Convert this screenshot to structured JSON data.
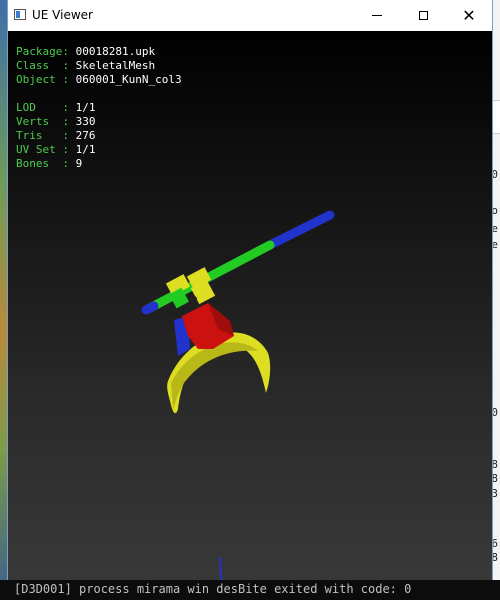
{
  "window": {
    "title": "UE Viewer",
    "icon": "app-window-icon"
  },
  "controls": {
    "minimize": "minimize-icon",
    "maximize": "maximize-icon",
    "close_label": "✕"
  },
  "info": {
    "package_label": "Package:",
    "package_value": "00018281.upk",
    "class_label": "Class  :",
    "class_value": "SkeletalMesh",
    "object_label": "Object :",
    "object_value": "060001_KunN_col3",
    "lod_label": "LOD    :",
    "lod_value": "1/1",
    "verts_label": "Verts  :",
    "verts_value": "330",
    "tris_label": "Tris   :",
    "tris_value": "276",
    "uvset_label": "UV Set :",
    "uvset_value": "1/1",
    "bones_label": "Bones  :",
    "bones_value": "9"
  },
  "background": {
    "console_text": "[D3D001] process  mirama win desBite  exited with code: 0",
    "glyphs": [
      "0",
      "o",
      "e",
      "e",
      "0",
      "8",
      "8",
      "3",
      "6",
      "8"
    ]
  },
  "colors": {
    "label": "#4ccc4c",
    "value": "#ffffff",
    "mesh_green": "#22cc22",
    "mesh_blue": "#2233cc",
    "mesh_yellow": "#dddd22",
    "mesh_red": "#cc1111"
  }
}
